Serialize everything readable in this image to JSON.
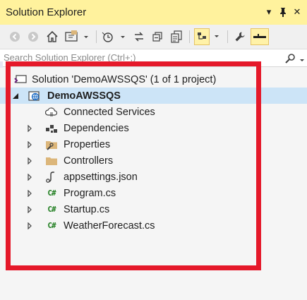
{
  "window": {
    "title": "Solution Explorer",
    "controls": [
      "▾",
      "⊓",
      "✕"
    ]
  },
  "search": {
    "placeholder": "Search Solution Explorer (Ctrl+;)"
  },
  "tree": [
    {
      "label": "Solution 'DemoAWSSQS' (1 of 1 project)",
      "icon": "solution-icon"
    },
    {
      "label": "DemoAWSSQS",
      "icon": "web-project-icon",
      "expanded": true,
      "selected": true
    },
    {
      "label": "Connected Services",
      "icon": "connected-services-icon"
    },
    {
      "label": "Dependencies",
      "icon": "dependencies-icon"
    },
    {
      "label": "Properties",
      "icon": "properties-folder-icon"
    },
    {
      "label": "Controllers",
      "icon": "folder-icon"
    },
    {
      "label": "appsettings.json",
      "icon": "json-file-icon"
    },
    {
      "label": "Program.cs",
      "icon": "csharp-file-icon",
      "badge": "C#"
    },
    {
      "label": "Startup.cs",
      "icon": "csharp-file-icon",
      "badge": "C#"
    },
    {
      "label": "WeatherForecast.cs",
      "icon": "csharp-file-icon",
      "badge": "C#"
    }
  ],
  "colors": {
    "title_bar": "#fff29d",
    "selection": "#cce4f7",
    "highlight_border": "#e5192a"
  }
}
